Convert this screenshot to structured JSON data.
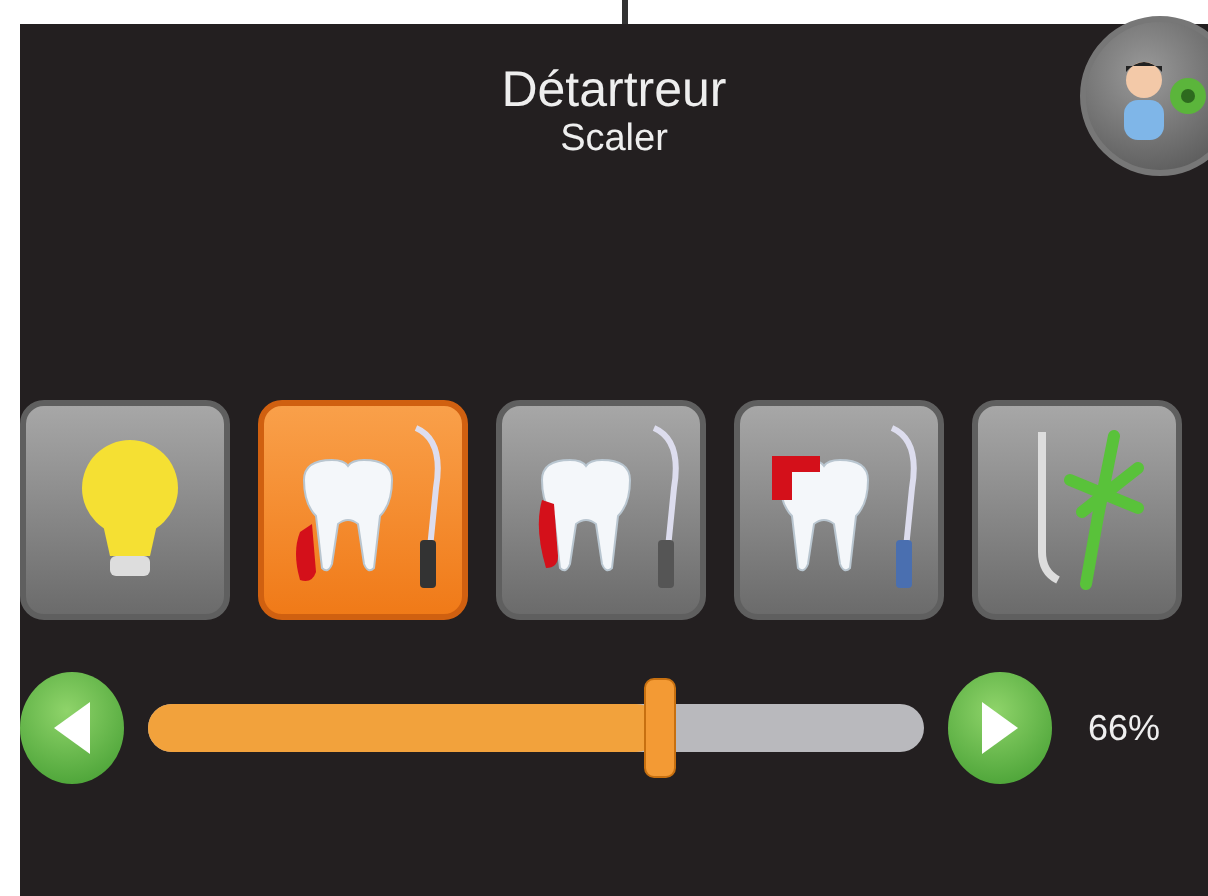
{
  "header": {
    "title": "Détartreur",
    "subtitle": "Scaler"
  },
  "modes": [
    {
      "kind": "light",
      "selected": false
    },
    {
      "kind": "scaler-gum",
      "selected": true
    },
    {
      "kind": "scaler-side",
      "selected": false
    },
    {
      "kind": "scaler-crown",
      "selected": false
    },
    {
      "kind": "tools",
      "selected": false
    }
  ],
  "power": {
    "level": 0.66,
    "reading": "66%"
  }
}
